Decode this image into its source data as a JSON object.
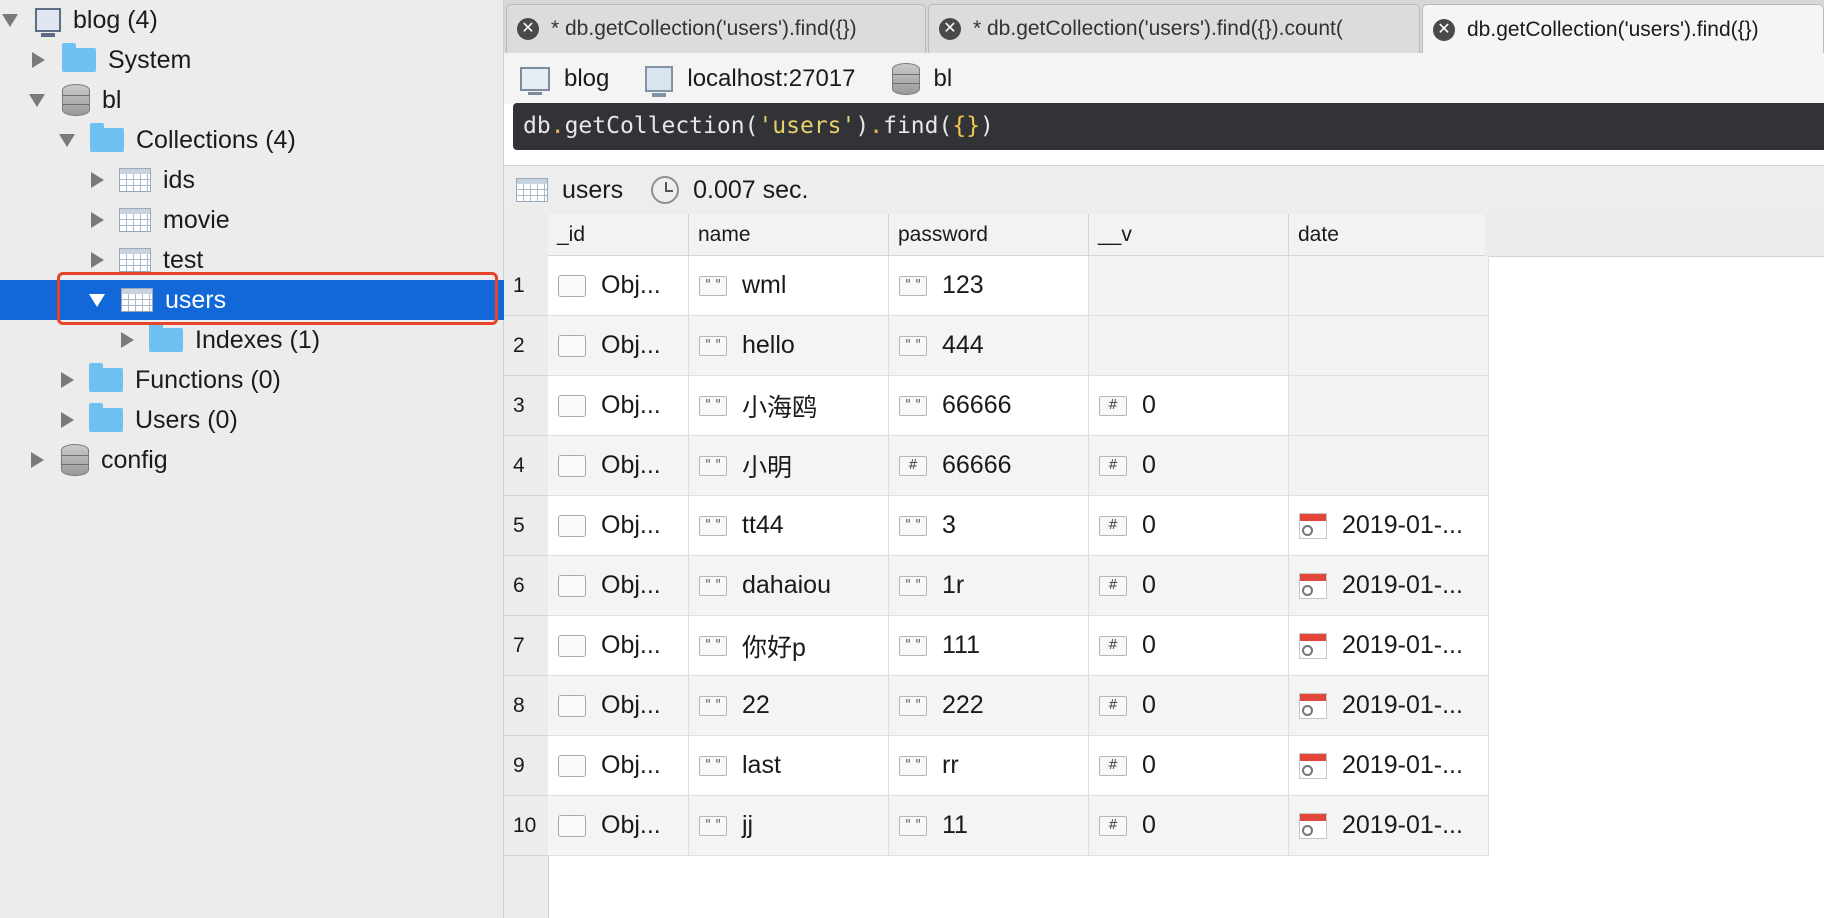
{
  "sidebar": {
    "items": [
      {
        "label": "blog (4)",
        "icon": "server-icon",
        "expanded": true
      },
      {
        "label": "System",
        "icon": "folder-icon",
        "expanded": false
      },
      {
        "label": "bl",
        "icon": "database-icon",
        "expanded": true
      },
      {
        "label": "Collections (4)",
        "icon": "folder-icon",
        "expanded": true
      },
      {
        "label": "ids",
        "icon": "collection-icon",
        "expanded": false
      },
      {
        "label": "movie",
        "icon": "collection-icon",
        "expanded": false
      },
      {
        "label": "test",
        "icon": "collection-icon",
        "expanded": false
      },
      {
        "label": "users",
        "icon": "collection-icon",
        "expanded": true,
        "selected": true
      },
      {
        "label": "Indexes (1)",
        "icon": "folder-icon",
        "expanded": false
      },
      {
        "label": "Functions (0)",
        "icon": "folder-icon",
        "expanded": false
      },
      {
        "label": "Users (0)",
        "icon": "folder-icon",
        "expanded": false
      },
      {
        "label": "config",
        "icon": "database-icon",
        "expanded": false
      }
    ],
    "selected_color": "#1268d9",
    "highlight_color": "#e5432a"
  },
  "tabs": [
    {
      "label": "* db.getCollection('users').find({})",
      "active": false
    },
    {
      "label": "* db.getCollection('users').find({}).count(",
      "active": false
    },
    {
      "label": "db.getCollection('users').find({})",
      "active": true
    }
  ],
  "connection": {
    "server": "blog",
    "host": "localhost:27017",
    "database": "bl"
  },
  "query": {
    "db": "db",
    "method1": "getCollection",
    "arg": "'users'",
    "method2": "find",
    "braces": "{}"
  },
  "result": {
    "collection": "users",
    "time": "0.007 sec."
  },
  "grid": {
    "columns": [
      "_id",
      "name",
      "password",
      "__v",
      "date"
    ],
    "rows": [
      {
        "num": "1",
        "id": "Obj...",
        "name": "wml",
        "password": "123",
        "password_type": "string",
        "v": "",
        "date": ""
      },
      {
        "num": "2",
        "id": "Obj...",
        "name": "hello",
        "password": "444",
        "password_type": "string",
        "v": "",
        "date": ""
      },
      {
        "num": "3",
        "id": "Obj...",
        "name": "小海鸥",
        "password": "66666",
        "password_type": "string",
        "v": "0",
        "date": ""
      },
      {
        "num": "4",
        "id": "Obj...",
        "name": "小明",
        "password": "66666",
        "password_type": "number",
        "v": "0",
        "date": ""
      },
      {
        "num": "5",
        "id": "Obj...",
        "name": "tt44",
        "password": "3",
        "password_type": "string",
        "v": "0",
        "date": "2019-01-..."
      },
      {
        "num": "6",
        "id": "Obj...",
        "name": "dahaiou",
        "password": "1r",
        "password_type": "string",
        "v": "0",
        "date": "2019-01-..."
      },
      {
        "num": "7",
        "id": "Obj...",
        "name": "你好p",
        "password": "111",
        "password_type": "string",
        "v": "0",
        "date": "2019-01-..."
      },
      {
        "num": "8",
        "id": "Obj...",
        "name": "22",
        "password": "222",
        "password_type": "string",
        "v": "0",
        "date": "2019-01-..."
      },
      {
        "num": "9",
        "id": "Obj...",
        "name": "last",
        "password": "rr",
        "password_type": "string",
        "v": "0",
        "date": "2019-01-..."
      },
      {
        "num": "10",
        "id": "Obj...",
        "name": "jj",
        "password": "11",
        "password_type": "string",
        "v": "0",
        "date": "2019-01-..."
      }
    ]
  }
}
